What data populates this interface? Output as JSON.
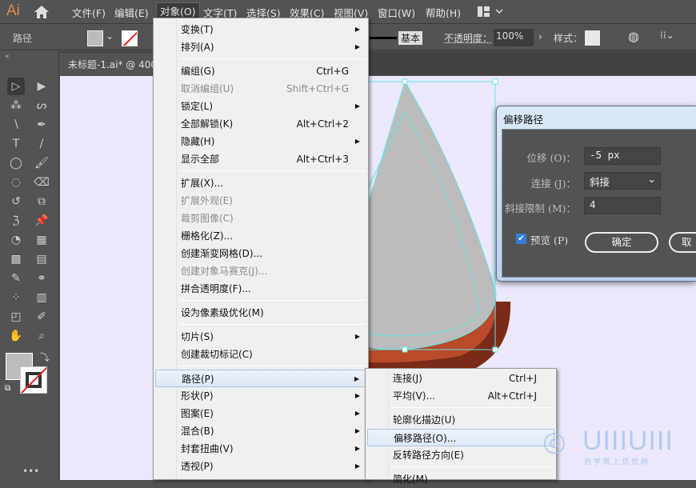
{
  "app": {
    "logo": "Ai",
    "tab_title": "未标题-1.ai* @ 400"
  },
  "menubar": [
    "文件(F)",
    "编辑(E)",
    "对象(O)",
    "文字(T)",
    "选择(S)",
    "效果(C)",
    "视图(V)",
    "窗口(W)",
    "帮助(H)"
  ],
  "control": {
    "selection": "路径",
    "stroke_style": "基本",
    "opacity_label": "不透明度：",
    "opacity": "100%",
    "style_label": "样式："
  },
  "menu": [
    {
      "label": "变换(T)",
      "arrow": true
    },
    {
      "label": "排列(A)",
      "arrow": true
    },
    {
      "sep": true
    },
    {
      "label": "编组(G)",
      "shortcut": "Ctrl+G"
    },
    {
      "label": "取消编组(U)",
      "shortcut": "Shift+Ctrl+G",
      "disabled": true
    },
    {
      "label": "锁定(L)",
      "arrow": true
    },
    {
      "label": "全部解锁(K)",
      "shortcut": "Alt+Ctrl+2"
    },
    {
      "label": "隐藏(H)",
      "arrow": true
    },
    {
      "label": "显示全部",
      "shortcut": "Alt+Ctrl+3"
    },
    {
      "sep": true
    },
    {
      "label": "扩展(X)..."
    },
    {
      "label": "扩展外观(E)",
      "disabled": true
    },
    {
      "label": "裁剪图像(C)",
      "disabled": true
    },
    {
      "label": "栅格化(Z)..."
    },
    {
      "label": "创建渐变网格(D)..."
    },
    {
      "label": "创建对象马赛克(J)...",
      "disabled": true
    },
    {
      "label": "拼合透明度(F)..."
    },
    {
      "sep": true
    },
    {
      "label": "设为像素级优化(M)"
    },
    {
      "sep": true
    },
    {
      "label": "切片(S)",
      "arrow": true
    },
    {
      "label": "创建裁切标记(C)"
    },
    {
      "sep": true
    },
    {
      "label": "路径(P)",
      "arrow": true,
      "highlighted": true
    },
    {
      "label": "形状(P)",
      "arrow": true
    },
    {
      "label": "图案(E)",
      "arrow": true
    },
    {
      "label": "混合(B)",
      "arrow": true
    },
    {
      "label": "封套扭曲(V)",
      "arrow": true
    },
    {
      "label": "透视(P)",
      "arrow": true
    }
  ],
  "submenu": [
    {
      "label": "连接(J)",
      "shortcut": "Ctrl+J"
    },
    {
      "label": "平均(V)...",
      "shortcut": "Alt+Ctrl+J"
    },
    {
      "sep": true
    },
    {
      "label": "轮廓化描边(U)"
    },
    {
      "label": "偏移路径(O)...",
      "highlighted": true
    },
    {
      "label": "反转路径方向(E)"
    },
    {
      "sep": true
    },
    {
      "label": "简化(M)"
    }
  ],
  "dialog": {
    "title": "偏移路径",
    "offset_label": "位移 (O)：",
    "offset": "-5 px",
    "join_label": "连接 (J)：",
    "join": "斜接",
    "miter_label": "斜接限制 (M)：",
    "miter": "4",
    "preview_label": "预览 (P)",
    "preview_checked": true,
    "ok": "确定",
    "cancel": "取"
  },
  "watermark": {
    "logo_text": "UIIIUIII",
    "tagline": "自 学 就 上 优 优 网"
  },
  "colors": {
    "accent": "#2f7fd8",
    "shape_fill": "#bcbcbc",
    "base": "#b94a2a",
    "base_dark": "#7a2c18",
    "selection": "#5fe8ea",
    "canvas": "#ebe9fb"
  }
}
